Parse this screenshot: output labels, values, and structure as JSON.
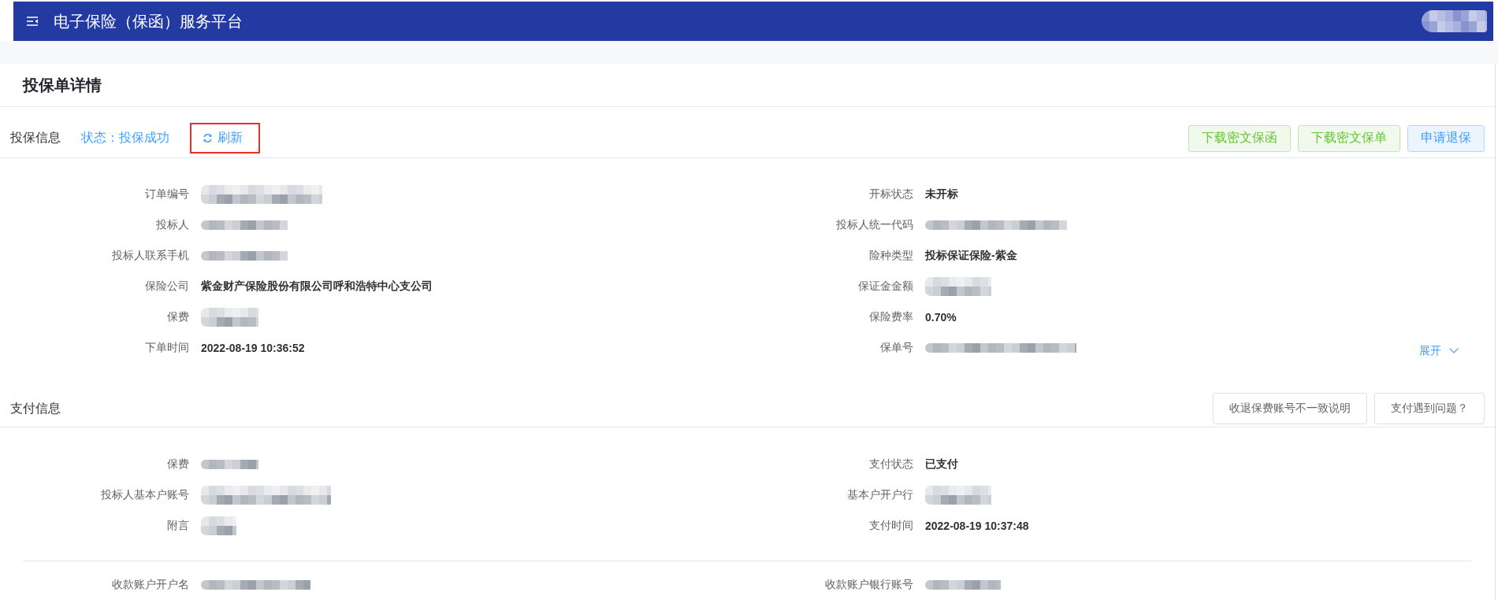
{
  "header": {
    "title": "电子保险（保函）服务平台",
    "user": {
      "redacted": true
    }
  },
  "page": {
    "title": "投保单详情"
  },
  "policy": {
    "title": "投保信息",
    "status": "状态：投保成功",
    "refresh": {
      "label": "刷新",
      "highlighted": true
    },
    "actions": [
      {
        "label": "下载密文保函",
        "kind": "success"
      },
      {
        "label": "下载密文保单",
        "kind": "success"
      },
      {
        "label": "申请退保",
        "kind": "primary"
      }
    ],
    "fields": [
      {
        "label": "订单编号",
        "redacted": true
      },
      {
        "label": "开标状态",
        "value": "未开标",
        "redacted": false
      },
      {
        "label": "投标人",
        "redacted": true
      },
      {
        "label": "投标人统一代码",
        "redacted": true
      },
      {
        "label": "投标人联系手机",
        "redacted": true
      },
      {
        "label": "险种类型",
        "value": "投标保证保险-紫金",
        "redacted": false
      },
      {
        "label": "保险公司",
        "value": "紫金财产保险股份有限公司呼和浩特中心支公司",
        "redacted": false
      },
      {
        "label": "保证金金额",
        "redacted": true
      },
      {
        "label": "保费",
        "redacted": true
      },
      {
        "label": "保险费率",
        "value": "0.70%",
        "redacted": false
      },
      {
        "label": "下单时间",
        "value": "2022-08-19 10:36:52",
        "redacted": false
      },
      {
        "label": "保单号",
        "redacted": true
      }
    ],
    "expand": {
      "label": "展开"
    }
  },
  "payment": {
    "title": "支付信息",
    "actions": [
      {
        "label": "收退保费账号不一致说明",
        "kind": "default"
      },
      {
        "label": "支付遇到问题？",
        "kind": "default"
      }
    ],
    "fields": [
      {
        "label": "保费",
        "redacted": true
      },
      {
        "label": "支付状态",
        "value": "已支付",
        "redacted": false
      },
      {
        "label": "投标人基本户账号",
        "redacted": true
      },
      {
        "label": "基本户开户行",
        "redacted": true
      },
      {
        "label": "附言",
        "redacted": true
      },
      {
        "label": "支付时间",
        "value": "2022-08-19 10:37:48",
        "redacted": false
      }
    ],
    "payee_fields": [
      {
        "label": "收款账户开户名",
        "redacted": true
      },
      {
        "label": "收款账户银行账号",
        "redacted": true
      }
    ]
  }
}
